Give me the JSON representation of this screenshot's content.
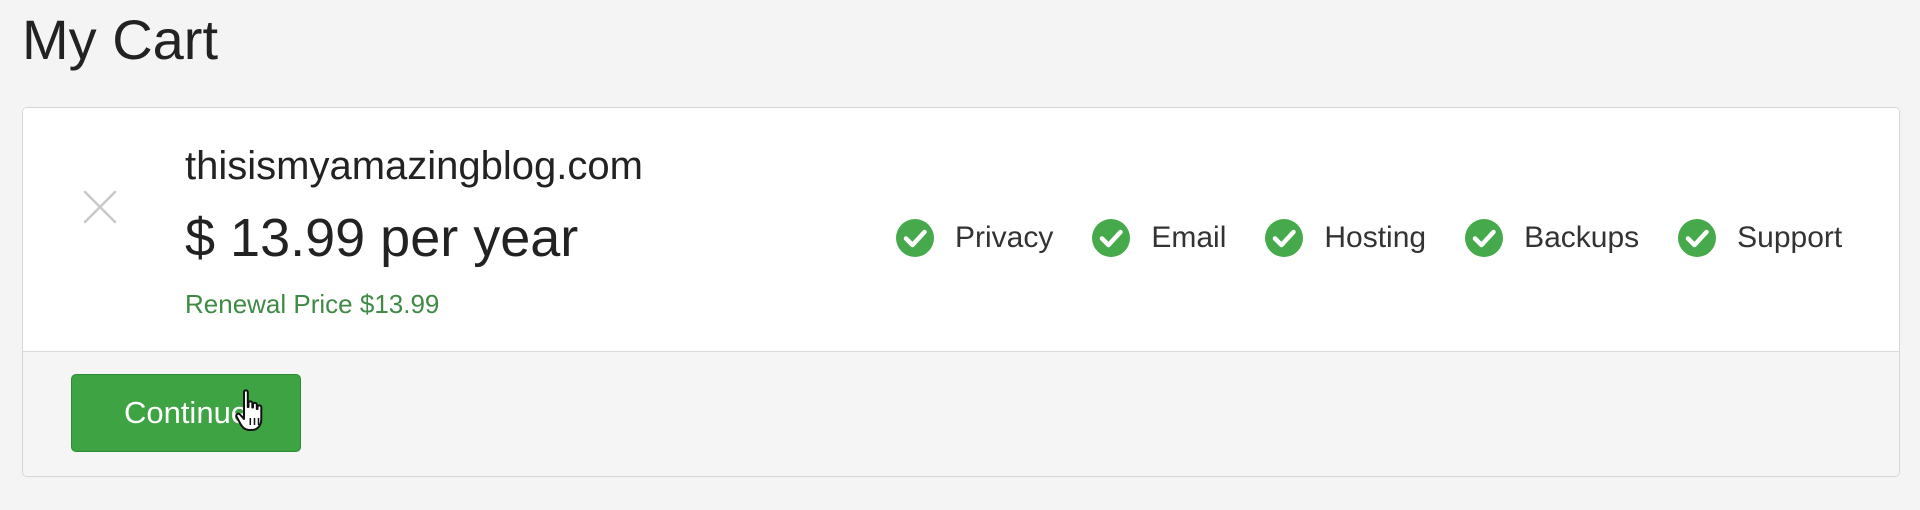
{
  "page": {
    "title": "My Cart"
  },
  "cart": {
    "item": {
      "domain": "thisismyamazingblog.com",
      "price": "$ 13.99 per year",
      "renewal": "Renewal Price $13.99",
      "remove_icon": "close-icon",
      "features": [
        {
          "label": "Privacy",
          "icon": "check-circle-icon"
        },
        {
          "label": "Email",
          "icon": "check-circle-icon"
        },
        {
          "label": "Hosting",
          "icon": "check-circle-icon"
        },
        {
          "label": "Backups",
          "icon": "check-circle-icon"
        },
        {
          "label": "Support",
          "icon": "check-circle-icon"
        }
      ]
    },
    "continue_label": "Continue"
  },
  "colors": {
    "accent_green": "#3da343",
    "renewal_text": "#3f8a45",
    "check_green": "#46a94c"
  },
  "cursor_icon": "hand-pointer-icon"
}
